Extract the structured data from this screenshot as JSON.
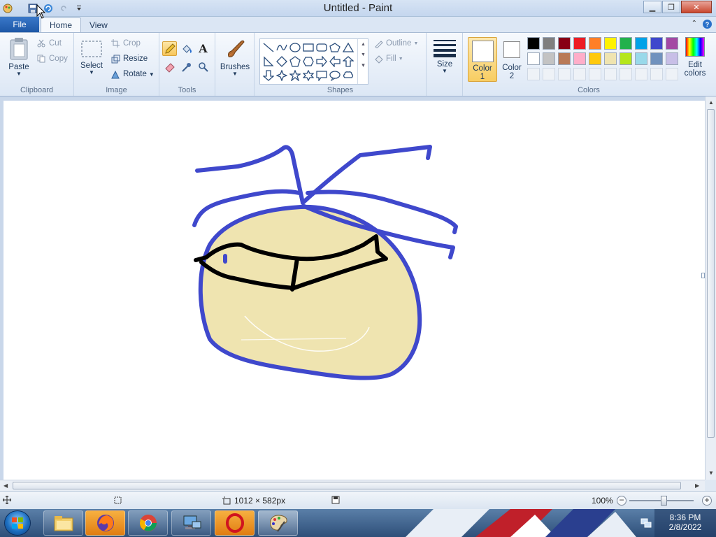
{
  "window": {
    "title": "Untitled - Paint"
  },
  "tabs": {
    "file": "File",
    "home": "Home",
    "view": "View"
  },
  "clipboard": {
    "paste": "Paste",
    "cut": "Cut",
    "copy": "Copy",
    "label": "Clipboard"
  },
  "image": {
    "select": "Select",
    "crop": "Crop",
    "resize": "Resize",
    "rotate": "Rotate",
    "label": "Image"
  },
  "tools": {
    "label": "Tools",
    "brushes": "Brushes"
  },
  "shapes": {
    "outline": "Outline",
    "fill": "Fill",
    "label": "Shapes"
  },
  "size": {
    "label": "Size"
  },
  "colors": {
    "color1_line1": "Color",
    "color1_line2": "1",
    "color2_line1": "Color",
    "color2_line2": "2",
    "edit_line1": "Edit",
    "edit_line2": "colors",
    "label": "Colors",
    "color1_value": "#ffffff",
    "color2_value": "#ffffff",
    "palette_row1": [
      "#000000",
      "#7f7f7f",
      "#880015",
      "#ed1c24",
      "#ff7f27",
      "#fff200",
      "#22b14c",
      "#00a2e8",
      "#3f48cc",
      "#a349a4"
    ],
    "palette_row2": [
      "#ffffff",
      "#c3c3c3",
      "#b97a57",
      "#ffaec9",
      "#ffc90e",
      "#efe4b0",
      "#b5e61d",
      "#99d9ea",
      "#7092be",
      "#c8bfe7"
    ]
  },
  "status": {
    "dimensions": "1012 × 582px",
    "zoom": "100%"
  },
  "taskbar": {
    "time": "8:36 PM",
    "date": "2/8/2022"
  }
}
